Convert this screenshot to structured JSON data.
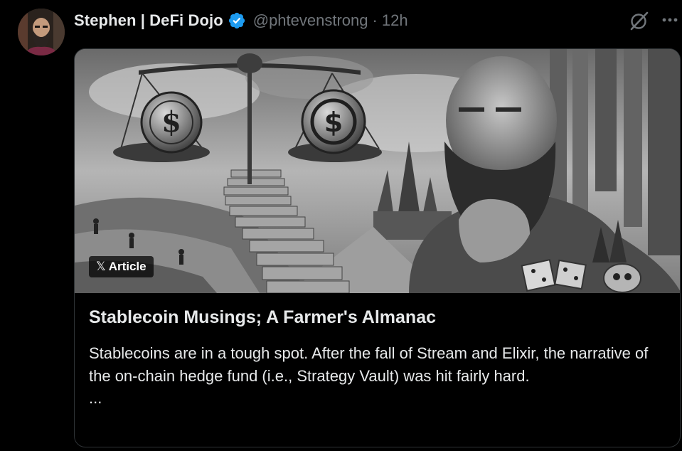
{
  "tweet": {
    "display_name": "Stephen | DeFi Dojo",
    "handle": "@phtevenstrong",
    "separator": "·",
    "time": "12h",
    "verified": true
  },
  "icons": {
    "avatar": "avatar",
    "verified": "verified-badge-icon",
    "grok": "grok-icon",
    "more": "more-options-icon",
    "x_logo": "x-logo-icon"
  },
  "card": {
    "badge": {
      "logo": "𝕏",
      "label": "Article"
    },
    "title": "Stablecoin Musings; A Farmer's Almanac",
    "description": "Stablecoins are in a tough spot. After the fall of Stream and Elixir, the narrative of the on-chain hedge fund (i.e., Strategy Vault) was hit fairly hard.",
    "ellipsis": "..."
  },
  "colors": {
    "background": "#000000",
    "text_primary": "#e7e9ea",
    "text_secondary": "#71767b",
    "border": "#2f3336",
    "verified_blue": "#1d9bf0"
  }
}
